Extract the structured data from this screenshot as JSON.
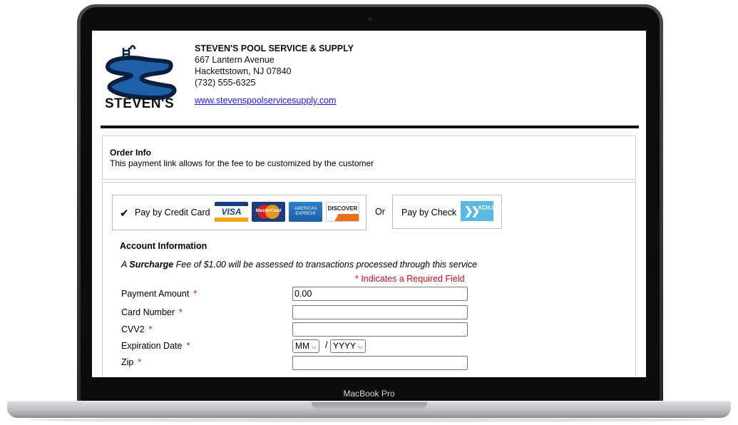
{
  "device": {
    "label": "MacBook Pro"
  },
  "merchant": {
    "logo_text": "STEVEN'S",
    "name": "STEVEN'S POOL SERVICE & SUPPLY",
    "address_line1": "667 Lantern Avenue",
    "address_line2": "Hackettstown, NJ 07840",
    "phone": "(732) 555-6325",
    "website": "www.stevenspoolservicesupply.com"
  },
  "order": {
    "title": "Order Info",
    "description": "This payment link allows for the fee to be customized by the customer"
  },
  "payment_methods": {
    "credit_card_label": "Pay by Credit Card",
    "card_brands": [
      "VISA",
      "MasterCard",
      "AMERICAN EXPRESS",
      "DISCOVER"
    ],
    "or_label": "Or",
    "check_label": "Pay by Check",
    "ach_badge": "ACH.COM",
    "selected": "credit_card"
  },
  "account": {
    "title": "Account Information",
    "surcharge_prefix": "A ",
    "surcharge_bold": "Surcharge",
    "surcharge_suffix": " Fee of $1.00 will be assessed to transactions processed through this service",
    "required_note": "* Indicates a Required Field",
    "fields": {
      "payment_amount": {
        "label": "Payment Amount",
        "value": "0.00"
      },
      "card_number": {
        "label": "Card Number",
        "value": ""
      },
      "cvv2": {
        "label": "CVV2",
        "value": ""
      },
      "expiration": {
        "label": "Expiration Date",
        "month": "MM",
        "year": "YYYY",
        "separator": "/"
      },
      "zip": {
        "label": "Zip",
        "value": ""
      }
    },
    "required_marker": "*"
  },
  "colors": {
    "required": "#c0101e",
    "link": "#1a1adb",
    "logo_blue": "#1f5fa8",
    "ach": "#5bb8e0"
  }
}
